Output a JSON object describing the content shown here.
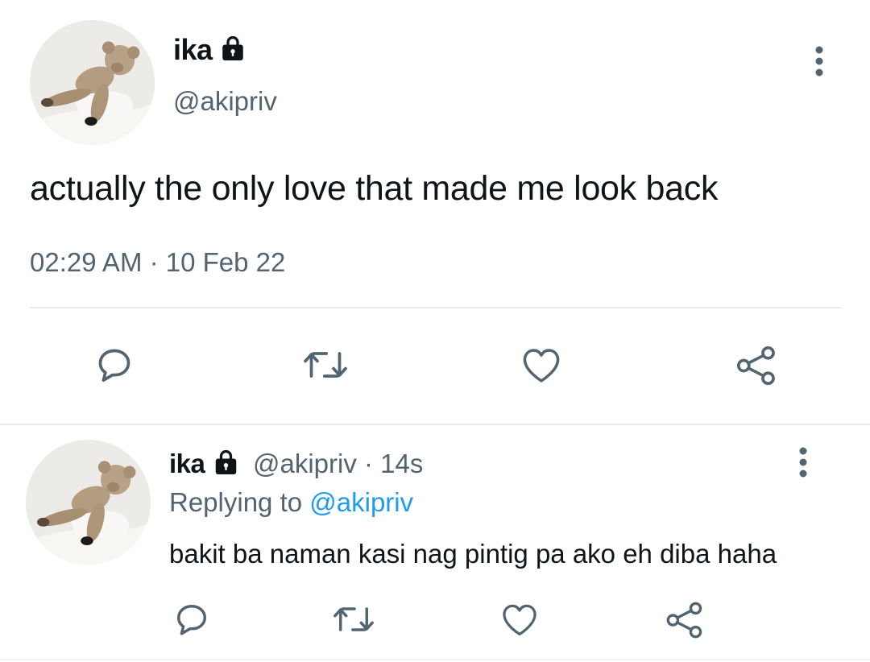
{
  "main_tweet": {
    "display_name": "ika",
    "handle": "@akipriv",
    "text": "actually the only love that made me look back",
    "timestamp": "02:29 AM · 10 Feb 22",
    "icons": {
      "lock": "lock-icon",
      "more": "more-vertical-icon",
      "reply": "reply-icon",
      "retweet": "retweet-icon",
      "like": "heart-icon",
      "share": "share-icon"
    }
  },
  "reply_tweet": {
    "display_name": "ika",
    "meta": "@akipriv · 14s",
    "replying_prefix": "Replying to ",
    "replying_to": "@akipriv",
    "text": "bakit ba naman kasi nag pintig pa ako eh diba haha"
  },
  "colors": {
    "text_primary": "#0f1419",
    "text_secondary": "#536471",
    "link": "#1d9bf0",
    "divider": "#e7e9ea"
  }
}
